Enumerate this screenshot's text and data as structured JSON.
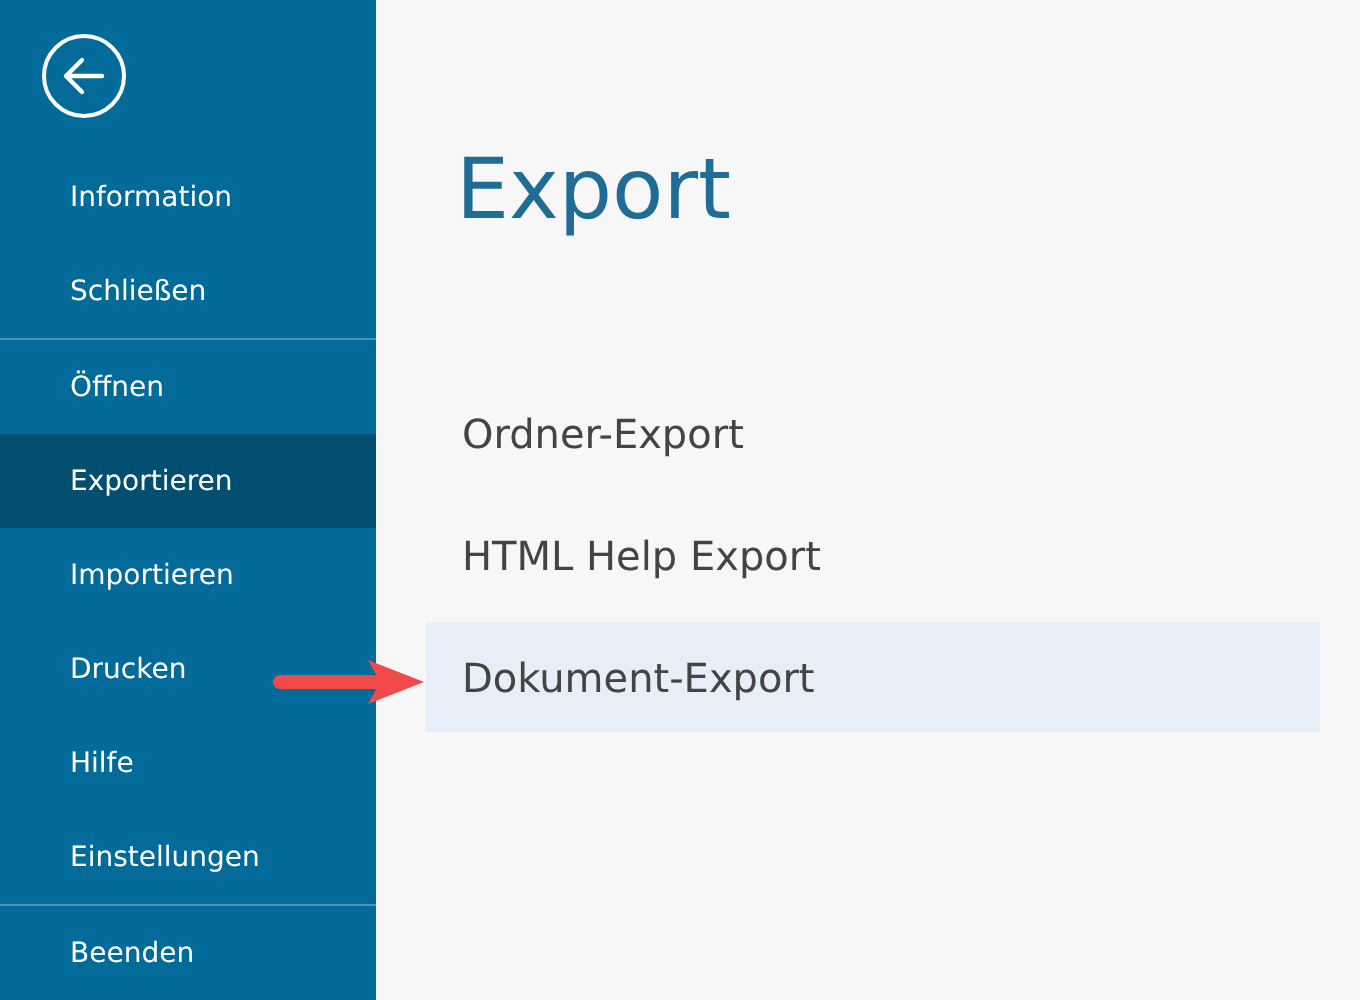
{
  "sidebar": {
    "groups": [
      [
        {
          "label": "Information",
          "selected": false
        },
        {
          "label": "Schließen",
          "selected": false
        }
      ],
      [
        {
          "label": "Öffnen",
          "selected": false
        },
        {
          "label": "Exportieren",
          "selected": true
        },
        {
          "label": "Importieren",
          "selected": false
        },
        {
          "label": "Drucken",
          "selected": false
        },
        {
          "label": "Hilfe",
          "selected": false
        },
        {
          "label": "Einstellungen",
          "selected": false
        }
      ],
      [
        {
          "label": "Beenden",
          "selected": false
        }
      ]
    ]
  },
  "main": {
    "title": "Export",
    "options": [
      {
        "label": "Ordner-Export",
        "selected": false
      },
      {
        "label": "HTML Help Export",
        "selected": false
      },
      {
        "label": "Dokument-Export",
        "selected": true
      }
    ]
  }
}
